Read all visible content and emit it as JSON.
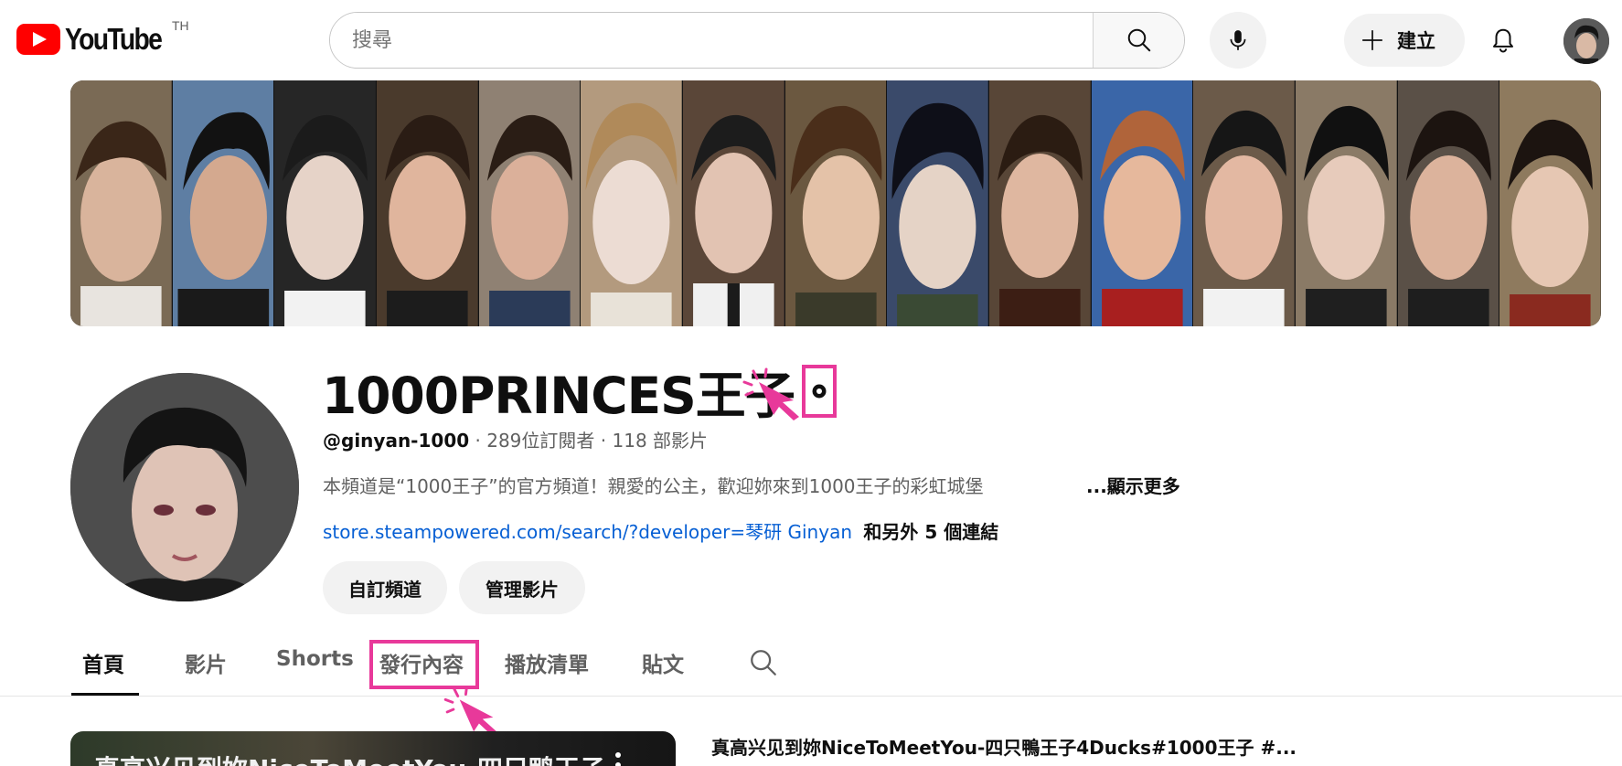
{
  "header": {
    "logo_text": "YouTube",
    "country_code": "TH",
    "search_placeholder": "搜尋",
    "create_label": "建立"
  },
  "channel": {
    "name": "1000PRINCES王子",
    "handle": "@ginyan-1000",
    "subscribers": "289位訂閱者",
    "videos": "118 部影片",
    "separator": "·",
    "description": "本頻道是“1000王子”的官方頻道！親愛的公主，歡迎妳來到1000王子的彩虹城堡",
    "show_more": "...顯示更多",
    "link_url": "store.steampowered.com/search/?developer=琴研 Ginyan",
    "link_more": "和另外 5 個連結",
    "customize_label": "自訂頻道",
    "manage_label": "管理影片"
  },
  "tabs": [
    {
      "label": "首頁",
      "active": true
    },
    {
      "label": "影片",
      "active": false
    },
    {
      "label": "Shorts",
      "active": false
    },
    {
      "label": "發行內容",
      "active": false,
      "highlighted": true
    },
    {
      "label": "播放清單",
      "active": false
    },
    {
      "label": "貼文",
      "active": false
    }
  ],
  "featured_video": {
    "thumbnail_text": "真高兴见到妳NiceToMeetYou-四只鸭王子",
    "title": "真高兴见到妳NiceToMeetYou-四只鴨王子4Ducks#1000王子 #..."
  },
  "colors": {
    "accent_red": "#ff0000",
    "link_blue": "#065fd4",
    "annotation_pink": "#e8399a"
  }
}
